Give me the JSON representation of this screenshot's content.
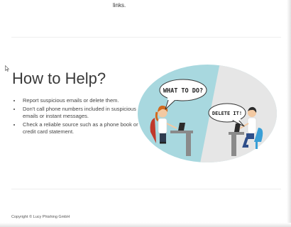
{
  "page": {
    "top_text": "links.",
    "title": "How to Help?",
    "bullets": [
      "Report suspicious emails or delete them.",
      "Don't call phone numbers included in suspicious emails or instant messages.",
      "Check a reliable source such as a phone book or credit card statement."
    ],
    "copyright": "Copyright © Lucy Phishing GmbH"
  },
  "illustration": {
    "bubble_left": "WHAT TO DO?",
    "bubble_right": "DELETE IT!"
  },
  "colors": {
    "circle_teal": "#a8d8df",
    "circle_grey": "#e6e6e6",
    "chair_red": "#c0392b",
    "chair_blue": "#3a9fd6",
    "desk_grey": "#8a8a8a"
  }
}
